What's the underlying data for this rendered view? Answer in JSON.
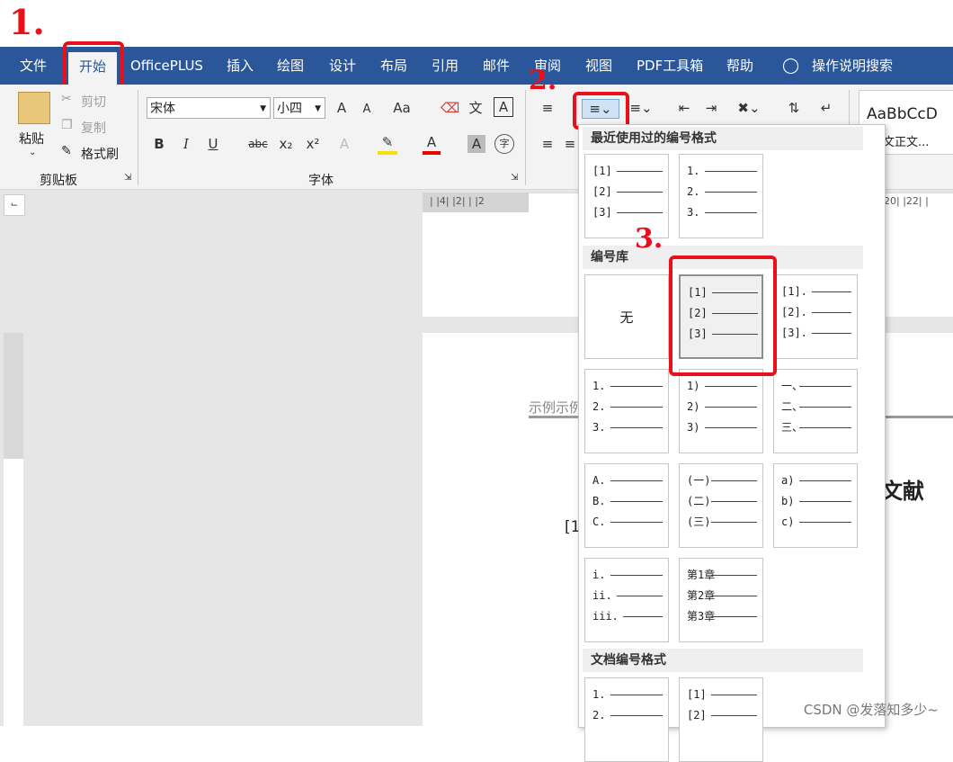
{
  "annotations": {
    "step1": "1.",
    "step2": "2.",
    "step3": "3."
  },
  "tabs": [
    "文件",
    "开始",
    "OfficePLUS",
    "插入",
    "绘图",
    "设计",
    "布局",
    "引用",
    "邮件",
    "审阅",
    "视图",
    "PDF工具箱",
    "帮助",
    "操作说明搜索"
  ],
  "clipboard": {
    "paste": "粘贴",
    "cut": "剪切",
    "copy": "复制",
    "format_painter": "格式刷",
    "group": "剪贴板"
  },
  "font": {
    "family": "宋体",
    "size": "小四",
    "group": "字体",
    "aa": "Aa",
    "bold": "B",
    "italic": "I",
    "underline": "U",
    "strike": "abc",
    "sub": "x₂",
    "sup": "x²",
    "grow": "A",
    "shrink": "A",
    "color_a": "A",
    "shade_a": "A",
    "wen": "文",
    "char": "字",
    "A_boxed": "A"
  },
  "styles": {
    "preview": "AaBbCcD",
    "name": "文正文..."
  },
  "dropdown": {
    "recent_header": "最近使用过的编号格式",
    "library_header": "编号库",
    "doc_header": "文档编号格式",
    "none_label": "无",
    "recent": [
      [
        "[1]",
        "[2]",
        "[3]"
      ],
      [
        "1.",
        "2.",
        "3."
      ]
    ],
    "library": [
      [
        "[1]",
        "[2]",
        "[3]"
      ],
      [
        "[1].",
        "[2].",
        "[3]."
      ],
      [
        "1.",
        "2.",
        "3."
      ],
      [
        "1)",
        "2)",
        "3)"
      ],
      [
        "一、",
        "二、",
        "三、"
      ],
      [
        "A.",
        "B.",
        "C."
      ],
      [
        "(一)",
        "(二)",
        "(三)"
      ],
      [
        "a)",
        "b)",
        "c)"
      ],
      [
        "i.",
        "ii.",
        "iii."
      ],
      [
        "第1章",
        "第2章",
        "第3章"
      ]
    ],
    "doc": [
      [
        "1.",
        "2."
      ],
      [
        "[1]",
        "[2]"
      ]
    ]
  },
  "doc": {
    "example_text": "示例示例",
    "heading_fragment": "文献",
    "bracket": "[1"
  },
  "ruler": {
    "h_marks": "| |4| |2| | |2",
    "h_marks_right": "20| |22| |"
  },
  "watermark": "CSDN @发落知多少~",
  "colors": {
    "ribbon_blue": "#2b579a",
    "annotation_red": "#e8101a"
  }
}
